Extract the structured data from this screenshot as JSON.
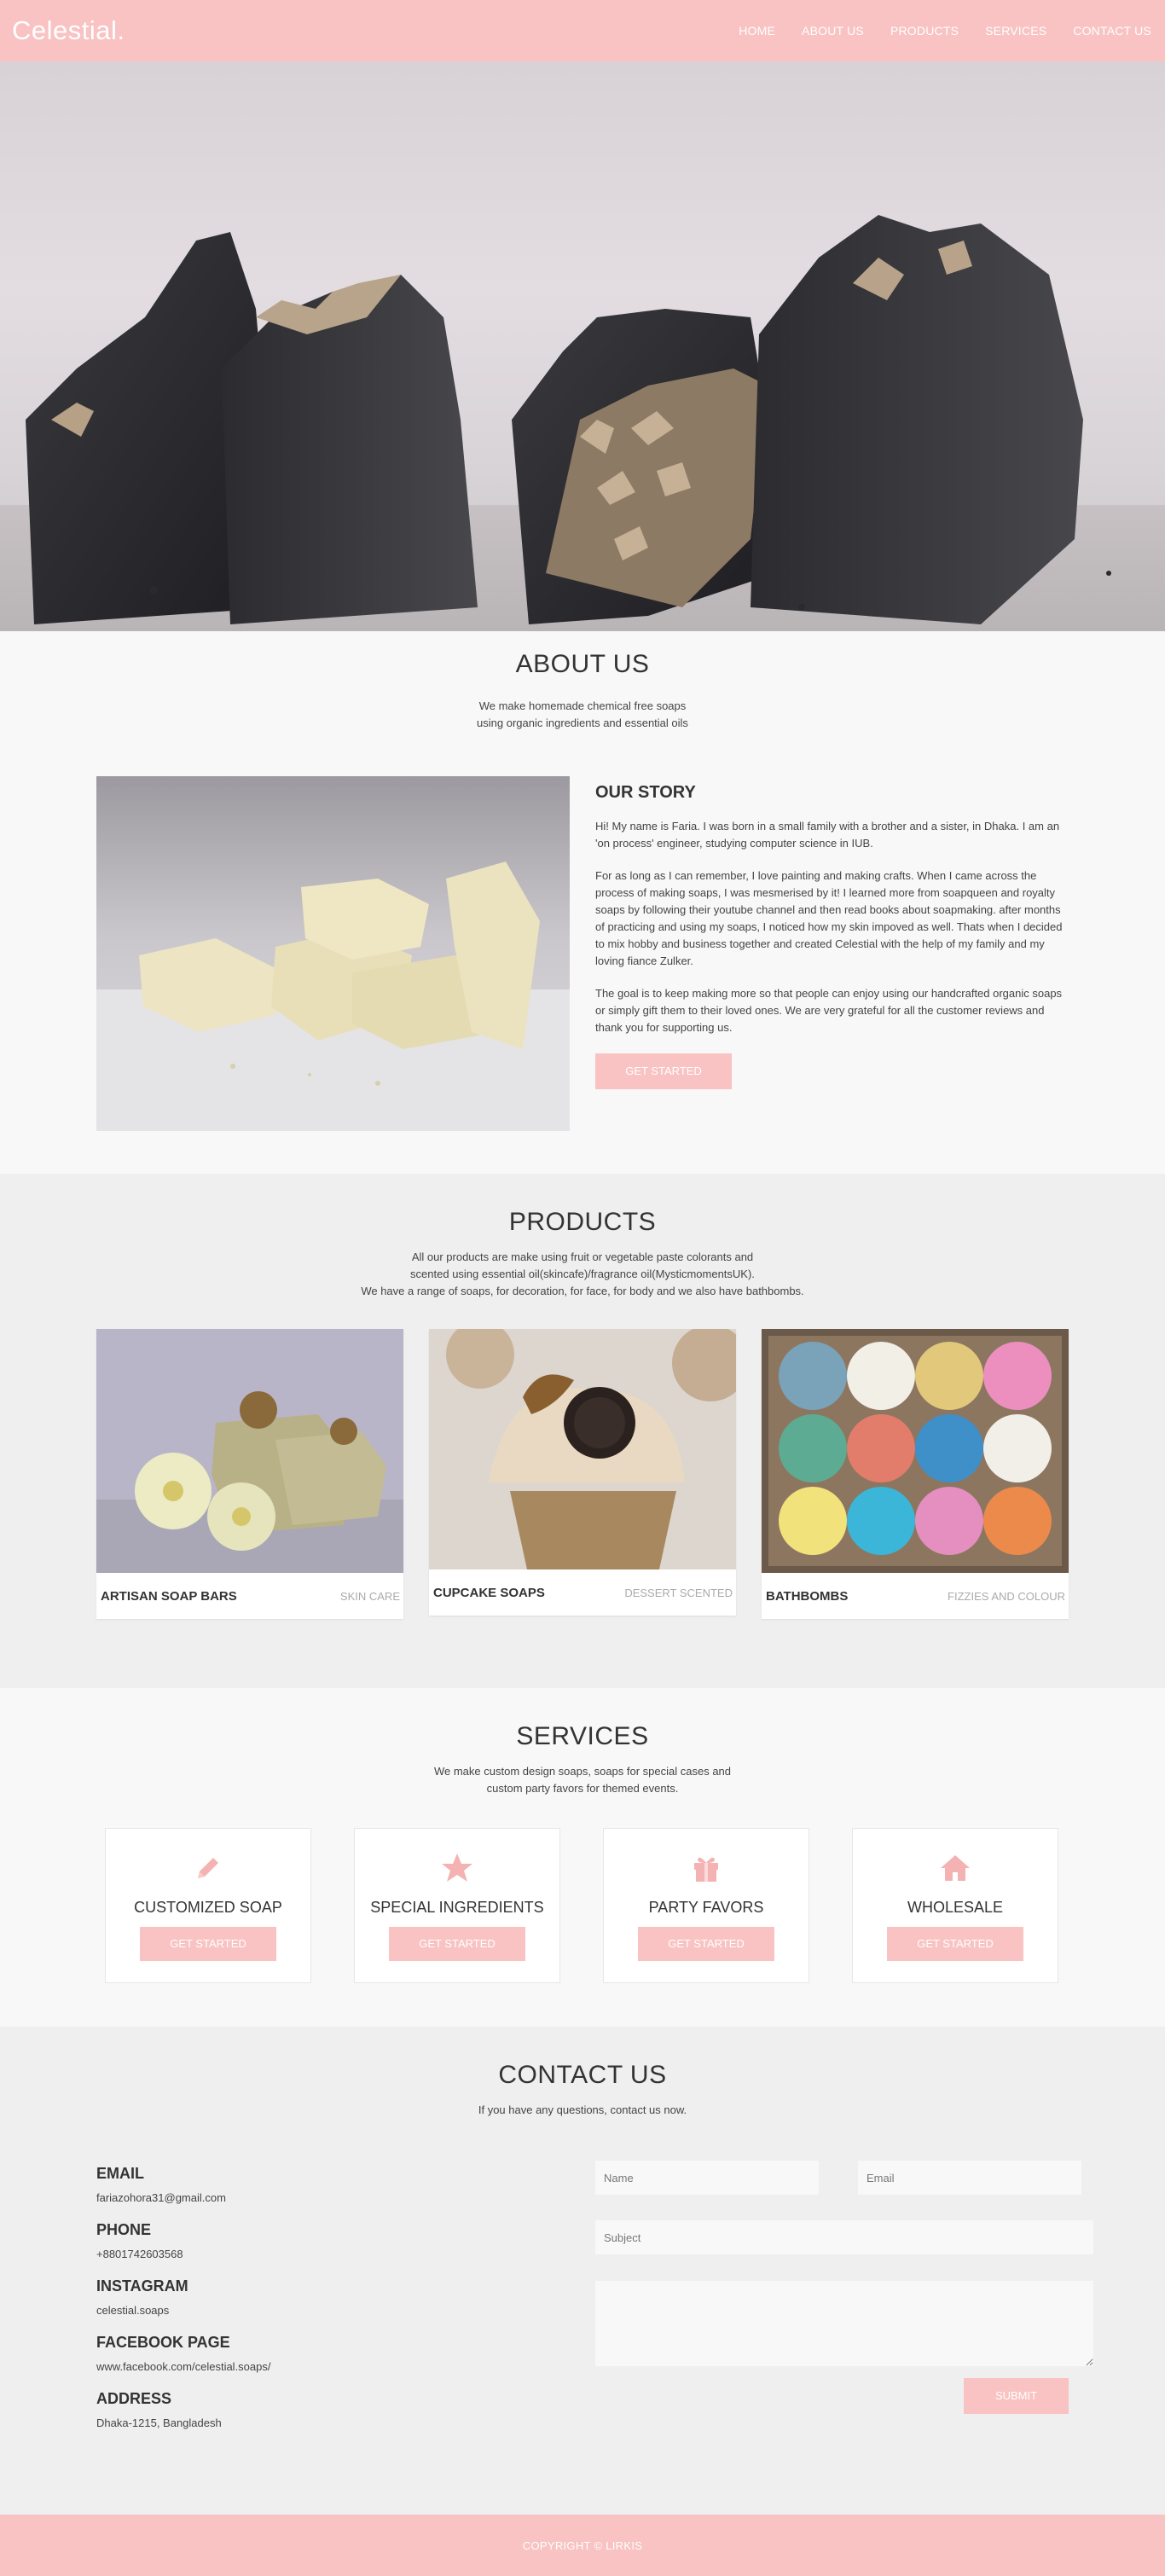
{
  "nav": {
    "logo": "Celestial.",
    "items": [
      "HOME",
      "ABOUT US",
      "PRODUCTS",
      "SERVICES",
      "CONTACT US"
    ]
  },
  "about": {
    "title": "ABOUT US",
    "subtitle_line1": "We make homemade chemical free soaps",
    "subtitle_line2": "using organic ingredients and essential oils",
    "story_title": "OUR STORY",
    "p1": "Hi! My name is Faria. I was born in a small family with a brother and a sister, in Dhaka. I am an 'on process' engineer, studying computer science in IUB.",
    "p2": "For as long as I can remember, I love painting and making crafts. When I came across the process of making soaps, I was mesmerised by it! I learned more from soapqueen and royalty soaps by following their youtube channel and then read books about soapmaking. after months of practicing and using my soaps, I noticed how my skin impoved as well. Thats when I decided to mix hobby and business together and created Celestial with the help of my family and my loving fiance Zulker.",
    "p3": "The goal is to keep making more so that people can enjoy using our handcrafted organic soaps or simply gift them to their loved ones. We are very grateful for all the customer reviews and thank you for supporting us.",
    "button": "GET STARTED"
  },
  "products": {
    "title": "PRODUCTS",
    "line1": "All our products are make using fruit or vegetable paste colorants and",
    "line2": "scented using essential oil(skincafe)/fragrance oil(MysticmomentsUK).",
    "line3": "We have a range of soaps, for decoration, for face, for body and we also have bathbombs.",
    "items": [
      {
        "name": "ARTISAN SOAP BARS",
        "tag": "SKIN CARE"
      },
      {
        "name": "CUPCAKE SOAPS",
        "tag": "DESSERT SCENTED"
      },
      {
        "name": "BATHBOMBS",
        "tag": "FIZZIES AND COLOUR"
      }
    ]
  },
  "services": {
    "title": "SERVICES",
    "line1": "We make custom design soaps, soaps for special cases and",
    "line2": "custom party favors for themed events.",
    "items": [
      {
        "icon": "pencil-icon",
        "label": "CUSTOMIZED SOAP",
        "button": "GET STARTED"
      },
      {
        "icon": "star-icon",
        "label": "SPECIAL INGREDIENTS",
        "button": "GET STARTED"
      },
      {
        "icon": "gift-icon",
        "label": "PARTY FAVORS",
        "button": "GET STARTED"
      },
      {
        "icon": "home-icon",
        "label": "WHOLESALE",
        "button": "GET STARTED"
      }
    ]
  },
  "contact": {
    "title": "CONTACT US",
    "subtitle": "If you have any questions, contact us now.",
    "email_label": "EMAIL",
    "email": "fariazohora31@gmail.com",
    "phone_label": "PHONE",
    "phone": "+8801742603568",
    "instagram_label": "INSTAGRAM",
    "instagram": "celestial.soaps",
    "facebook_label": "FACEBOOK PAGE",
    "facebook": "www.facebook.com/celestial.soaps/",
    "address_label": "ADDRESS",
    "address": "Dhaka-1215, Bangladesh",
    "form": {
      "name_placeholder": "Name",
      "email_placeholder": "Email",
      "subject_placeholder": "Subject",
      "message_placeholder": "",
      "submit": "SUBMIT"
    }
  },
  "footer": {
    "copyright": "COPYRIGHT © LIRKIS"
  },
  "colors": {
    "accent": "#f8c3c2",
    "text": "#333333",
    "muted": "#aaaaaa"
  }
}
